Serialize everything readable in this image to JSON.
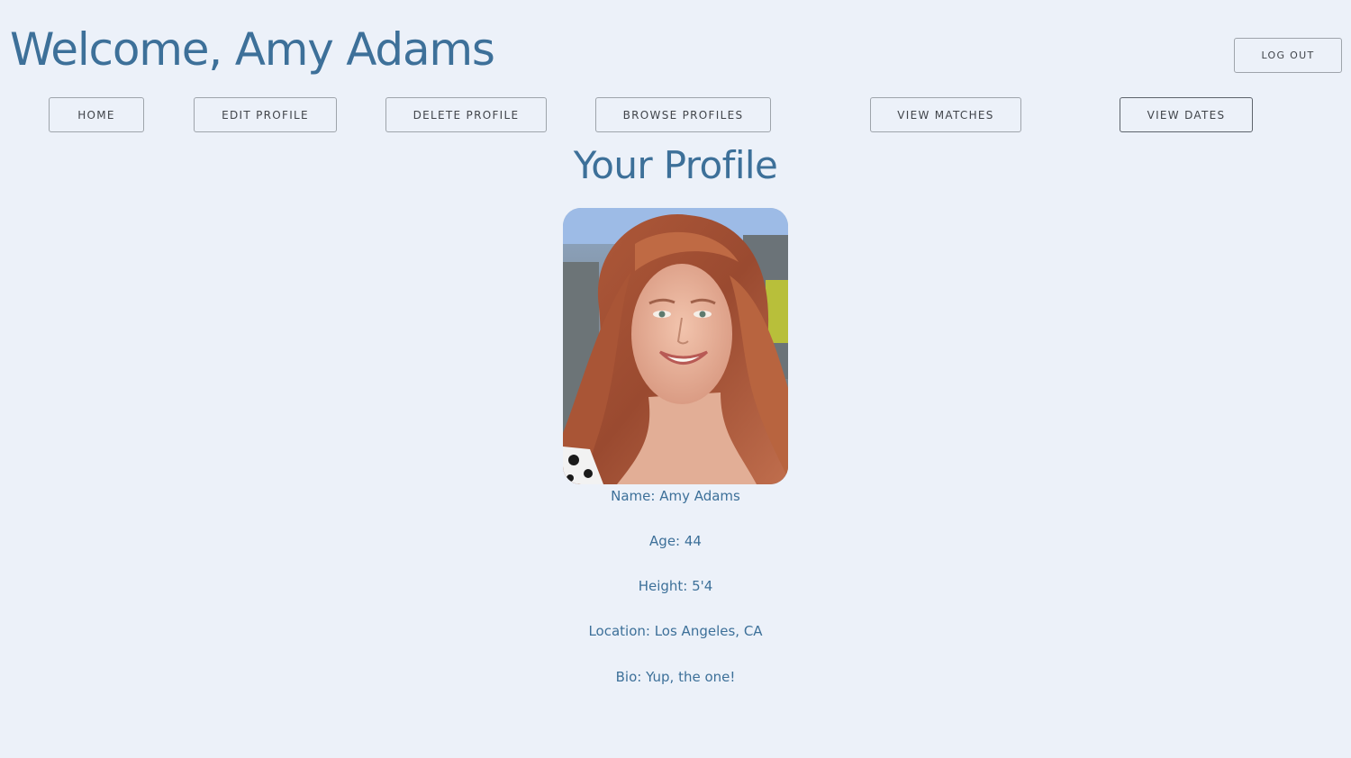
{
  "header": {
    "welcome_text": "Welcome, Amy Adams",
    "logout_label": "LOG OUT"
  },
  "nav": {
    "home": "HOME",
    "edit_profile": "EDIT PROFILE",
    "delete_profile": "DELETE PROFILE",
    "browse_profiles": "BROWSE PROFILES",
    "view_matches": "VIEW MATCHES",
    "view_dates": "VIEW DATES"
  },
  "profile": {
    "section_title": "Your Profile",
    "name_line": "Name: Amy Adams",
    "age_line": "Age: 44",
    "height_line": "Height: 5'4",
    "location_line": "Location: Los Angeles, CA",
    "bio_line": "Bio: Yup, the one!"
  },
  "colors": {
    "background": "#ecf1f9",
    "accent_text": "#3d7099",
    "button_text": "#40444a",
    "button_border": "#9ea4ab"
  },
  "icons": {
    "profile_photo": "portrait-photo"
  }
}
